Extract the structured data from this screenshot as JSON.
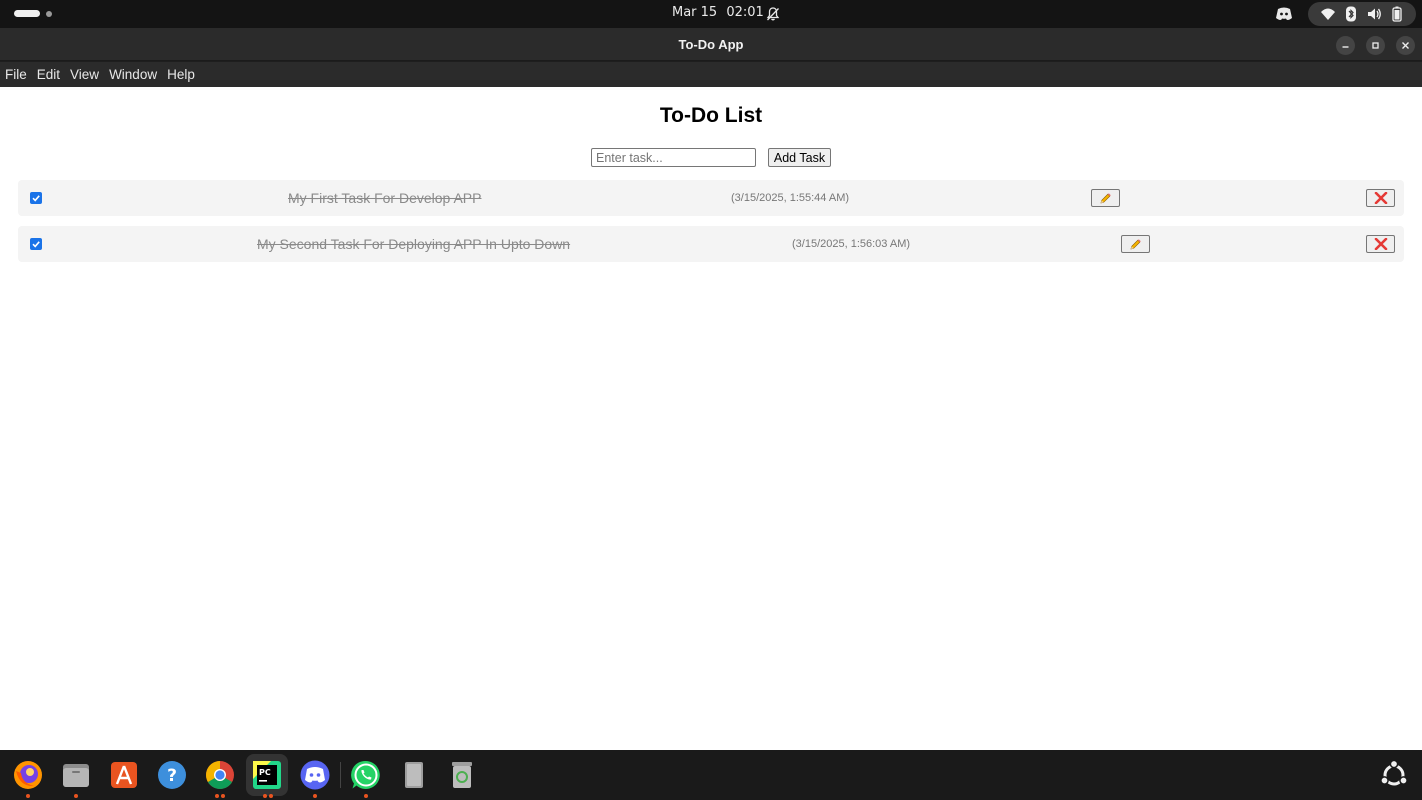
{
  "system": {
    "date": "Mar 15",
    "time": "02:01"
  },
  "window": {
    "title": "To-Do App"
  },
  "menu": [
    "File",
    "Edit",
    "View",
    "Window",
    "Help"
  ],
  "app": {
    "heading": "To-Do List",
    "input_placeholder": "Enter task...",
    "input_value": "",
    "add_label": "Add Task",
    "edit_icon": "pencil-icon",
    "delete_icon": "red-x-icon",
    "tasks": [
      {
        "text": "My First Task For Develop APP",
        "time": "(3/15/2025, 1:55:44 AM)",
        "completed": true
      },
      {
        "text": "My Second Task For Deploying APP In Upto Down",
        "time": "(3/15/2025, 1:56:03 AM)",
        "completed": true
      }
    ]
  },
  "dock": {
    "apps": [
      "firefox-icon",
      "files-icon",
      "app-center-icon",
      "help-icon",
      "chrome-icon",
      "pycharm-icon",
      "discord-icon",
      "whatsapp-icon",
      "text-editor-icon",
      "trash-icon",
      "show-apps-icon"
    ],
    "active_app": "pycharm-icon"
  },
  "colors": {
    "accent": "#1a73e8",
    "delete": "#e53935",
    "ubuntu_orange": "#e95420"
  }
}
